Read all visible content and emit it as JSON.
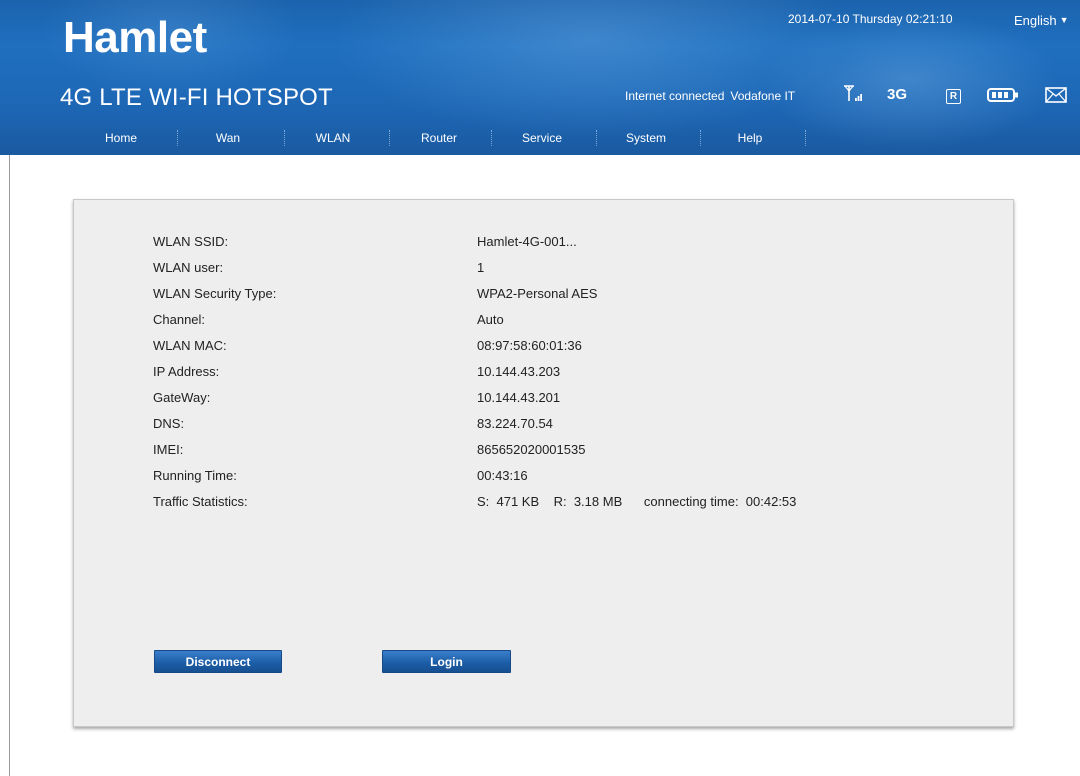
{
  "header": {
    "logo": "Hamlet",
    "tagline": "4G LTE WI-FI HOTSPOT",
    "datetime": "2014-07-10 Thursday 02:21:10",
    "language": "English",
    "connection_status": "Internet connected",
    "carrier": "Vodafone IT",
    "network_type": "3G",
    "roaming_badge": "R",
    "icons": [
      "signal-icon",
      "roaming-icon",
      "battery-icon",
      "mail-icon"
    ]
  },
  "nav": {
    "items": [
      {
        "label": "Home"
      },
      {
        "label": "Wan"
      },
      {
        "label": "WLAN"
      },
      {
        "label": "Router"
      },
      {
        "label": "Service"
      },
      {
        "label": "System"
      },
      {
        "label": "Help"
      }
    ]
  },
  "info": {
    "rows": [
      {
        "label": "WLAN SSID:",
        "value": "Hamlet-4G-001..."
      },
      {
        "label": "WLAN user:",
        "value": "1"
      },
      {
        "label": "WLAN Security Type:",
        "value": "WPA2-Personal AES"
      },
      {
        "label": "Channel:",
        "value": "Auto"
      },
      {
        "label": "WLAN MAC:",
        "value": "08:97:58:60:01:36"
      },
      {
        "label": "IP Address:",
        "value": "10.144.43.203"
      },
      {
        "label": "GateWay:",
        "value": "10.144.43.201"
      },
      {
        "label": "DNS:",
        "value": "83.224.70.54"
      },
      {
        "label": "IMEI:",
        "value": "865652020001535"
      },
      {
        "label": "Running Time:",
        "value": "00:43:16"
      },
      {
        "label": "Traffic Statistics:",
        "value": "S:  471 KB    R:  3.18 MB      connecting time:  00:42:53"
      }
    ]
  },
  "buttons": {
    "disconnect": "Disconnect",
    "login": "Login"
  },
  "colors": {
    "header_blue": "#1f6fbf",
    "button_blue": "#1d5ea8",
    "panel_bg": "#eeeeee"
  }
}
